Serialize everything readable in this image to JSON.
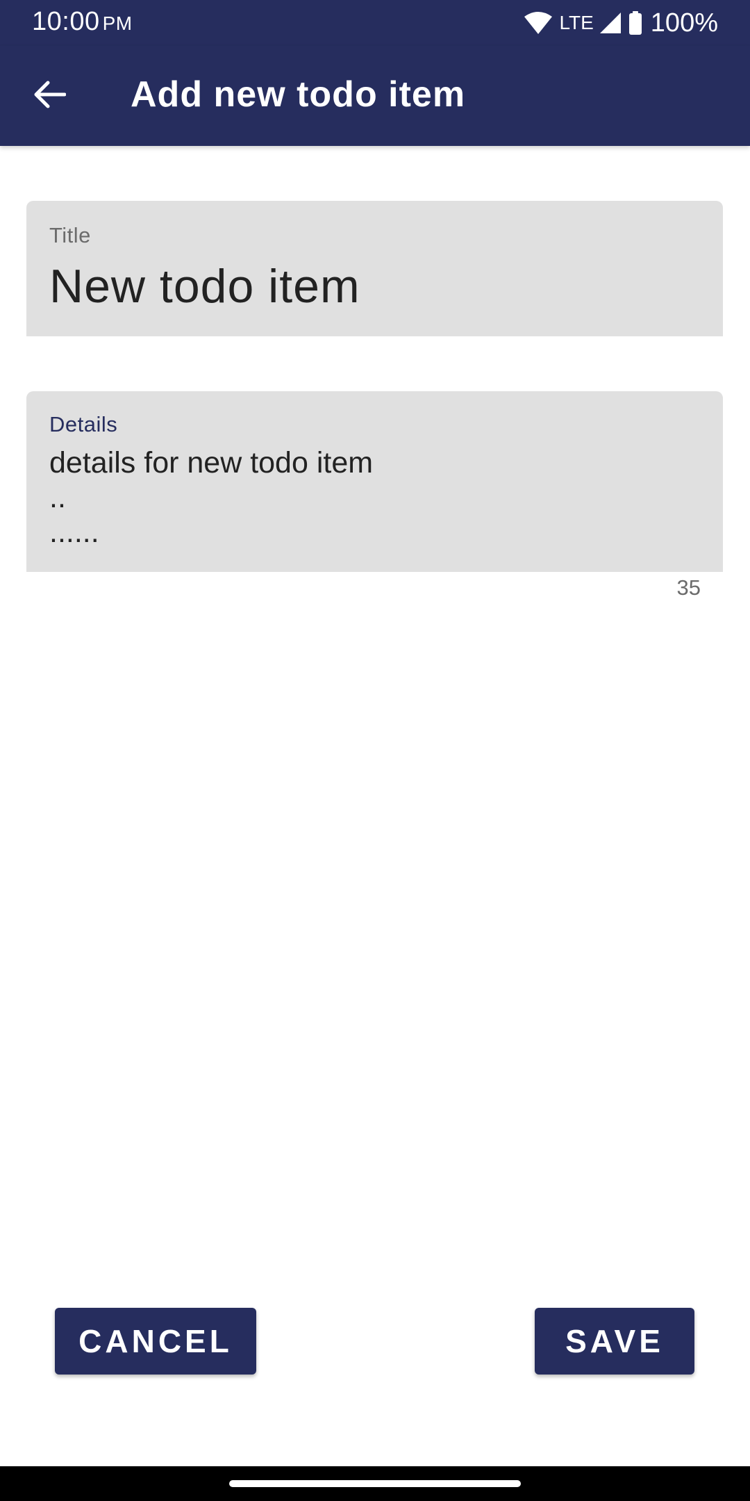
{
  "status_bar": {
    "time": "10:00",
    "ampm": "PM",
    "network": "LTE",
    "battery": "100%",
    "icons": [
      "wifi-icon",
      "cell-signal-icon",
      "battery-icon"
    ]
  },
  "app_bar": {
    "title": "Add new todo item",
    "back_icon": "arrow-back-icon"
  },
  "form": {
    "title_field": {
      "label": "Title",
      "value": "New todo item"
    },
    "details_field": {
      "label": "Details",
      "value": "details for new todo item\n..\n......",
      "counter": "35"
    }
  },
  "actions": {
    "cancel_label": "CANCEL",
    "save_label": "SAVE"
  },
  "colors": {
    "primary": "#262d5e",
    "field_background": "#e0e0e0",
    "text": "#222222",
    "secondary_text": "#6b6b6b"
  }
}
